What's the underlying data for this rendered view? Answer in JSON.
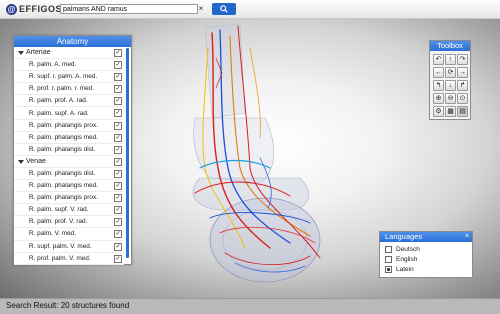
{
  "topbar": {
    "logo_text": "EFFIGOS",
    "logo_mark": "@",
    "search_value": "palmaris AND ramus",
    "clear_symbol": "×"
  },
  "anatomy": {
    "title": "Anatomy",
    "groups": [
      {
        "name": "Arteriae",
        "items": [
          "R. palm. A. med.",
          "R. supf. r. palm. A. med.",
          "R. prof. r. palm. r. med.",
          "R. palm. prof. A. rad.",
          "R. palm. supf. A. rad.",
          "R. palm. phalangis prox.",
          "R. palm. phalangis med.",
          "R. palm. phalangis dist."
        ]
      },
      {
        "name": "Venae",
        "items": [
          "R. palm. phalangis dist.",
          "R. palm. phalangis med.",
          "R. palm. phalangis prox.",
          "R. palm. supf. V. rad.",
          "R. palm. prof. V. rad.",
          "R. palm. V. med.",
          "R. supf. palm. V. med.",
          "R. prof. palm. V. med."
        ]
      }
    ],
    "checkbox_mark": "✓"
  },
  "toolbox": {
    "title": "Toolbox",
    "buttons": [
      "↶",
      "↑",
      "↷",
      "←",
      "⟳",
      "→",
      "↰",
      "↓",
      "↱",
      "⊕",
      "⊖",
      "⊙",
      "⚙",
      "▦",
      "▤"
    ]
  },
  "languages": {
    "title": "Languages",
    "close": "×",
    "options": [
      {
        "label": "Deutsch",
        "selected": false
      },
      {
        "label": "English",
        "selected": false
      },
      {
        "label": "Latein",
        "selected": true
      }
    ]
  },
  "status": {
    "text": "Search Result: 20 structures found"
  }
}
